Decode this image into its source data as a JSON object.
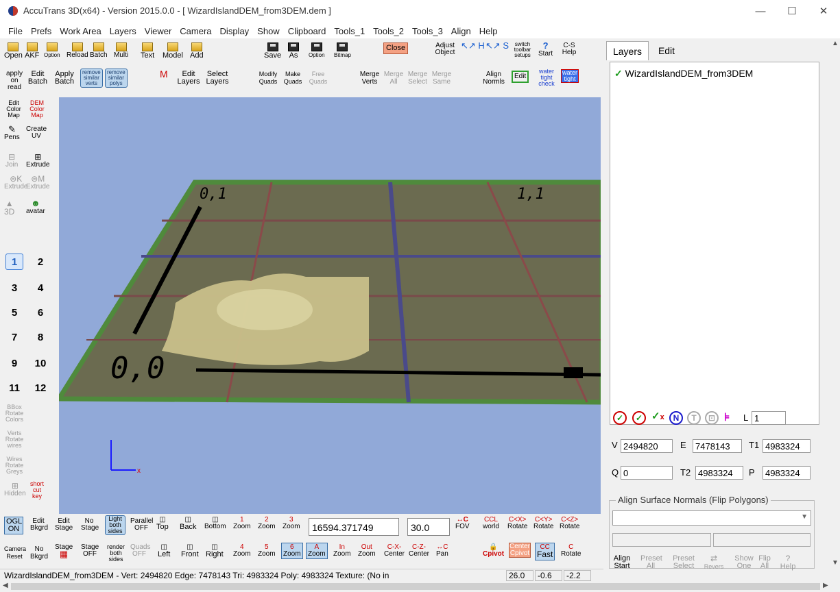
{
  "window": {
    "title": "AccuTrans 3D(x64) - Version 2015.0.0 - [ WizardIslandDEM_from3DEM.dem ]",
    "minimize": "—",
    "maximize": "☐",
    "close": "✕"
  },
  "menu": [
    "File",
    "Prefs",
    "Work Area",
    "Layers",
    "Viewer",
    "Camera",
    "Display",
    "Show",
    "Clipboard",
    "Tools_1",
    "Tools_2",
    "Tools_3",
    "Align",
    "Help"
  ],
  "toolbar": {
    "row1": {
      "open": "Open",
      "akf": "AKF",
      "option": "Option",
      "reload": "Reload",
      "batch": "Batch",
      "multi": "Multi",
      "text": "Text",
      "model": "Model",
      "add": "Add",
      "save": "Save",
      "as": "As",
      "option2": "Option",
      "bitmap": "Bitmap",
      "close": "Close",
      "adjust_object": "Adjust Object",
      "switch_toolbar_setups": "switch toolbar setups",
      "cs_help": "C-S Help",
      "start": "Start"
    },
    "row2": {
      "apply_on_read": "apply on read",
      "edit_batch": "Edit Batch",
      "apply_batch": "Apply Batch",
      "remove_similar_verts": "remove similar verts",
      "remove_similar_polys": "remove similar polys",
      "edit_layers": "Edit Layers",
      "select_layers": "Select Layers",
      "modify_quads": "Modify Quads",
      "make_quads": "Make Quads",
      "free_quads": "Free Quads",
      "merge_verts": "Merge Verts",
      "merge_all": "Merge All",
      "merge_select": "Merge Select",
      "merge_same": "Merge Same",
      "align_normals": "Align Normls",
      "edit": "Edit",
      "water_tight_check": "water tight check",
      "water_tight": "water tight"
    }
  },
  "lefttools": {
    "edit_color_map": "Edit Color Map",
    "dem_color_map": "DEM Color Map",
    "pens": "Pens",
    "create_uv": "Create UV",
    "join": "Join",
    "extrude": "Extrude",
    "extrude_k": "Extrude",
    "extrude_m": "Extrude",
    "to_3d": "3D",
    "avatar": "avatar",
    "numbers": [
      "1",
      "2",
      "3",
      "4",
      "5",
      "6",
      "7",
      "8",
      "9",
      "10",
      "11",
      "12"
    ],
    "rotate_colors": "Rotate Colors",
    "rotate_wires": "Rotate wires",
    "rotate_greys": "Rotate Greys",
    "hidden": "Hidden",
    "short_cut_key": "short cut key",
    "bbox": "BBox",
    "verts": "Verts",
    "wires": "Wires"
  },
  "viewport": {
    "labels": [
      "0,1",
      "1,1",
      "0,0"
    ],
    "background": "#91a9d8"
  },
  "rightpanel": {
    "tabs": [
      "Layers",
      "Edit"
    ],
    "layer_name": "WizardIslandDEM_from3DEM",
    "l_field": "1",
    "v_label": "V",
    "v_value": "2494820",
    "e_label": "E",
    "e_value": "7478143",
    "t1_label": "T1",
    "t1_value": "4983324",
    "q_label": "Q",
    "q_value": "0",
    "t2_label": "T2",
    "t2_value": "4983324",
    "p_label": "P",
    "p_value": "4983324",
    "align_group": "Align Surface Normals (Flip Polygons)",
    "align_start": "Align Start",
    "preset_all": "Preset All",
    "preset_select": "Preset Select",
    "revers": "Revers",
    "show_one": "Show One",
    "flip_all": "Flip All",
    "help": "Help",
    "n_btn": "N",
    "t_btn": "T",
    "l_label": "L"
  },
  "bottombar": {
    "ogl_on": "OGL ON",
    "edit_bkgrd": "Edit Bkgrd",
    "edit_stage": "Edit Stage",
    "no_stage": "No Stage",
    "light_both_sides": "Light both sides",
    "parallel_off": "Parallel OFF",
    "top": "Top",
    "back": "Back",
    "bottom": "Bottom",
    "zoom1": "Zoom",
    "zoom2": "Zoom",
    "zoom3": "Zoom",
    "distance_value": "16594.371749",
    "fov_value": "30.0",
    "fov": "FOV",
    "world": "world",
    "rotate_x": "Rotate",
    "rotate_y": "Rotate",
    "rotate_z": "Rotate",
    "camera_reset": "Camera Reset",
    "no_bkgrd": "No Bkgrd",
    "stage": "Stage",
    "stage_uv_off": "Stage OFF",
    "render_both_sides": "render both sides",
    "quads_off": "Quads OFF",
    "left": "Left",
    "front": "Front",
    "right": "Right",
    "zoom4": "Zoom",
    "zoom5": "Zoom",
    "zoom6": "Zoom",
    "zoom_a": "Zoom",
    "zoom_in": "Zoom",
    "zoom_out": "Zoom",
    "center": "Center",
    "center2": "Center",
    "pan": "Pan",
    "pivot": "Cpivot",
    "center_pivot": "Center Cpivot",
    "fast": "Fast",
    "rotate_c": "Rotate",
    "zoom_labels": [
      "1",
      "2",
      "3",
      "4",
      "5",
      "6",
      "A",
      "In",
      "Out"
    ]
  },
  "status": {
    "text": "WizardIslandDEM_from3DEM  -  Vert: 2494820  Edge: 7478143  Tri: 4983324  Poly: 4983324  Texture: (No in",
    "v1": "26.0",
    "v2": "-0.6",
    "v3": "-2.2"
  }
}
